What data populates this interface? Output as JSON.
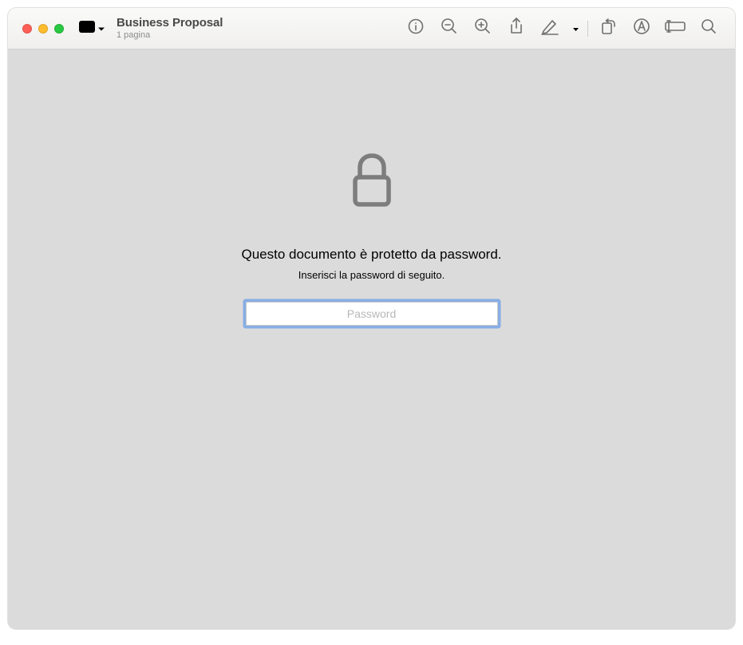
{
  "window": {
    "doc_title": "Business Proposal",
    "doc_subtitle": "1 pagina"
  },
  "toolbar_icons": {
    "sidebar": "sidebar-icon",
    "info": "info-icon",
    "zoom_out": "zoom-out-icon",
    "zoom_in": "zoom-in-icon",
    "share": "share-icon",
    "markup": "markup-icon",
    "rotate": "rotate-icon",
    "highlight": "highlight-text-icon",
    "form": "form-icon",
    "search": "search-icon"
  },
  "lock_panel": {
    "heading": "Questo documento è protetto da password.",
    "sub": "Inserisci la password di seguito.",
    "placeholder": "Password"
  }
}
